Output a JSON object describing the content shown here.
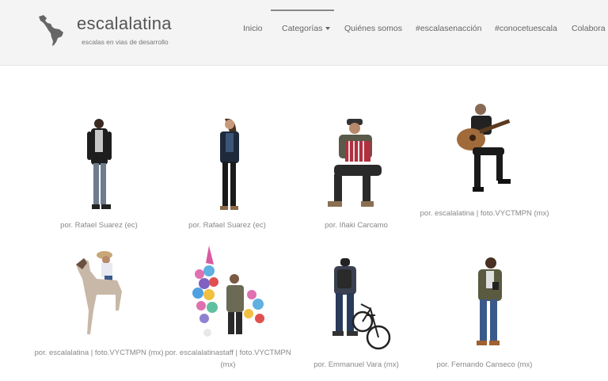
{
  "site": {
    "title": "escalalatina",
    "tagline": "escalas en vias de desarrollo"
  },
  "nav": {
    "items": [
      {
        "label": "Inicio"
      },
      {
        "label": "Categorías"
      },
      {
        "label": "Quiénes somos"
      },
      {
        "label": "#escalasenacción"
      },
      {
        "label": "#conocetuescala"
      },
      {
        "label": "Colabora"
      }
    ]
  },
  "gallery": {
    "items": [
      {
        "caption": "por. Rafael Suarez (ec)",
        "icon": "standing-man-figure"
      },
      {
        "caption": "por. Rafael Suarez (ec)",
        "icon": "standing-woman-figure"
      },
      {
        "caption": "por. Iñaki Carcamo",
        "icon": "accordion-player-figure"
      },
      {
        "caption": "por. escalalatina | foto.VYCTMPN (mx)",
        "icon": "guitar-player-figure"
      },
      {
        "caption": "por. escalalatina | foto.VYCTMPN (mx)",
        "icon": "horse-rider-figure"
      },
      {
        "caption": "por. escalalatinastaff | foto.VYCTMPN (mx)",
        "icon": "balloon-vendor-figure"
      },
      {
        "caption": "por. Emmanuel Vara (mx)",
        "icon": "cyclist-figure"
      },
      {
        "caption": "por. Fernando Canseco (mx)",
        "icon": "man-with-phone-figure"
      }
    ]
  }
}
